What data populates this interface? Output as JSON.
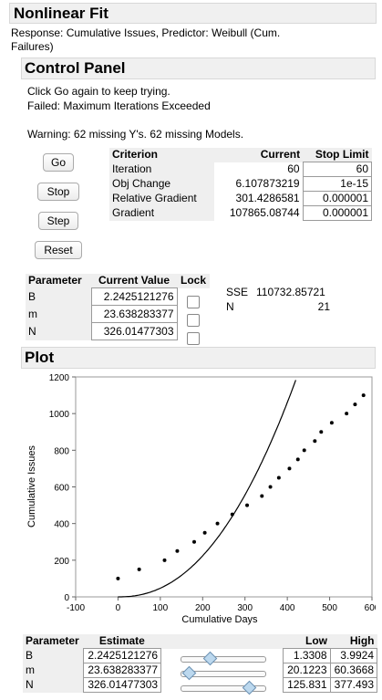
{
  "report": {
    "title": "Nonlinear Fit",
    "response_line1": "Response: Cumulative Issues, Predictor: Weibull (Cum.",
    "response_line2": "Failures)"
  },
  "control_panel": {
    "title": "Control Panel",
    "message1": "Click Go again to keep trying.",
    "message2": "Failed: Maximum Iterations Exceeded",
    "warning": "Warning: 62 missing Y's. 62 missing Models.",
    "buttons": {
      "go": "Go",
      "stop": "Stop",
      "step": "Step",
      "reset": "Reset"
    },
    "criterion_table": {
      "headers": [
        "Criterion",
        "Current",
        "Stop Limit"
      ],
      "rows": [
        {
          "name": "Iteration",
          "current": "60",
          "limit": "60"
        },
        {
          "name": "Obj Change",
          "current": "6.107873219",
          "limit": "1e-15"
        },
        {
          "name": "Relative Gradient",
          "current": "301.4286581",
          "limit": "0.000001"
        },
        {
          "name": "Gradient",
          "current": "107865.08744",
          "limit": "0.000001"
        }
      ]
    },
    "parameter_table": {
      "headers": [
        "Parameter",
        "Current Value",
        "Lock"
      ],
      "rows": [
        {
          "name": "B",
          "value": "2.2425121276"
        },
        {
          "name": "m",
          "value": "23.638283377"
        },
        {
          "name": "N",
          "value": "326.01477303"
        }
      ]
    },
    "sse_label": "SSE",
    "sse_value": "110732.85721",
    "n_label": "N",
    "n_value": "21"
  },
  "plot": {
    "title": "Plot",
    "xlabel": "Cumulative Days",
    "ylabel": "Cumulative Issues"
  },
  "chart_data": {
    "type": "scatter",
    "xlabel": "Cumulative Days",
    "ylabel": "Cumulative Issues",
    "xlim": [
      -100,
      600
    ],
    "ylim": [
      0,
      1200
    ],
    "x_ticks": [
      -100,
      0,
      100,
      200,
      300,
      400,
      500,
      600
    ],
    "y_ticks": [
      0,
      200,
      400,
      600,
      800,
      1000,
      1200
    ],
    "points": [
      [
        0,
        100
      ],
      [
        50,
        150
      ],
      [
        110,
        200
      ],
      [
        140,
        250
      ],
      [
        180,
        300
      ],
      [
        205,
        350
      ],
      [
        235,
        400
      ],
      [
        270,
        450
      ],
      [
        305,
        500
      ],
      [
        340,
        550
      ],
      [
        360,
        600
      ],
      [
        380,
        650
      ],
      [
        405,
        700
      ],
      [
        425,
        750
      ],
      [
        440,
        800
      ],
      [
        465,
        850
      ],
      [
        480,
        900
      ],
      [
        505,
        950
      ],
      [
        540,
        1000
      ],
      [
        560,
        1050
      ],
      [
        580,
        1100
      ]
    ],
    "fit_curve": {
      "model": "Weibull cumulative",
      "params": {
        "B": 2.2425121276,
        "m": 23.638283377,
        "N": 326.01477303
      }
    },
    "grid": false
  },
  "estimate_table": {
    "headers": [
      "Parameter",
      "Estimate",
      "",
      "Low",
      "High"
    ],
    "rows": [
      {
        "name": "B",
        "estimate": "2.2425121276",
        "low": "1.3308",
        "high": "3.9924",
        "slider_fraction": 0.34
      },
      {
        "name": "m",
        "estimate": "23.638283377",
        "low": "20.1223",
        "high": "60.3668",
        "slider_fraction": 0.09
      },
      {
        "name": "N",
        "estimate": "326.01477303",
        "low": "125.831",
        "high": "377.493",
        "slider_fraction": 0.8
      }
    ]
  },
  "colors": {
    "header_bg": "#f0f0f0",
    "slider_thumb": "#bcd8ee"
  }
}
